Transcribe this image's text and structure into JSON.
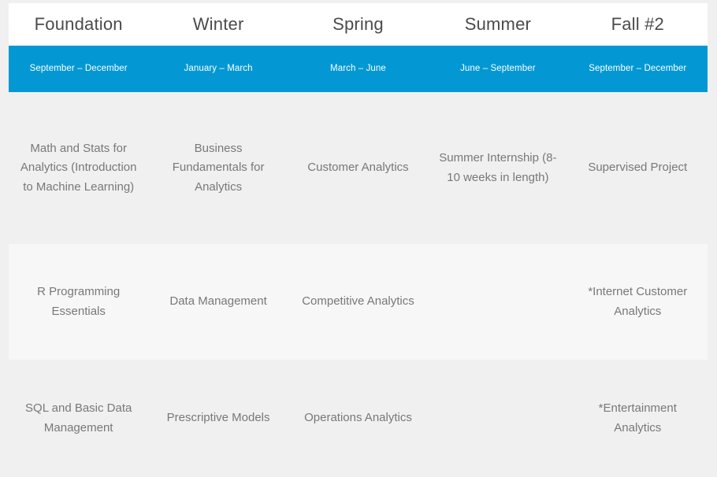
{
  "theme": {
    "accent": "#0398d4",
    "header_text": "#4b4b4b",
    "cell_text": "#77787b",
    "row_a_bg": "#f0f0f0",
    "row_b_bg": "#f7f7f7",
    "term_bg": "#ffffff",
    "page_bg": "#f0f0f0"
  },
  "table": {
    "columns": [
      {
        "term": "Foundation",
        "dates": "September – December"
      },
      {
        "term": "Winter",
        "dates": "January – March"
      },
      {
        "term": "Spring",
        "dates": "March – June"
      },
      {
        "term": "Summer",
        "dates": "June – September"
      },
      {
        "term": "Fall #2",
        "dates": "September – December"
      }
    ],
    "rows": [
      {
        "cells": [
          "Math and Stats for Analytics (Introduction to Machine Learning)",
          "Business Fundamentals for Analytics",
          "Customer Analytics",
          "Summer Internship (8-10 weeks in length)",
          "Supervised Project"
        ]
      },
      {
        "cells": [
          "R Programming Essentials",
          "Data Management",
          "Competitive Analytics",
          "",
          "*Internet Customer Analytics"
        ]
      },
      {
        "cells": [
          "SQL and Basic Data Management",
          "Prescriptive Models",
          "Operations Analytics",
          "",
          "*Entertainment Analytics"
        ]
      }
    ]
  }
}
